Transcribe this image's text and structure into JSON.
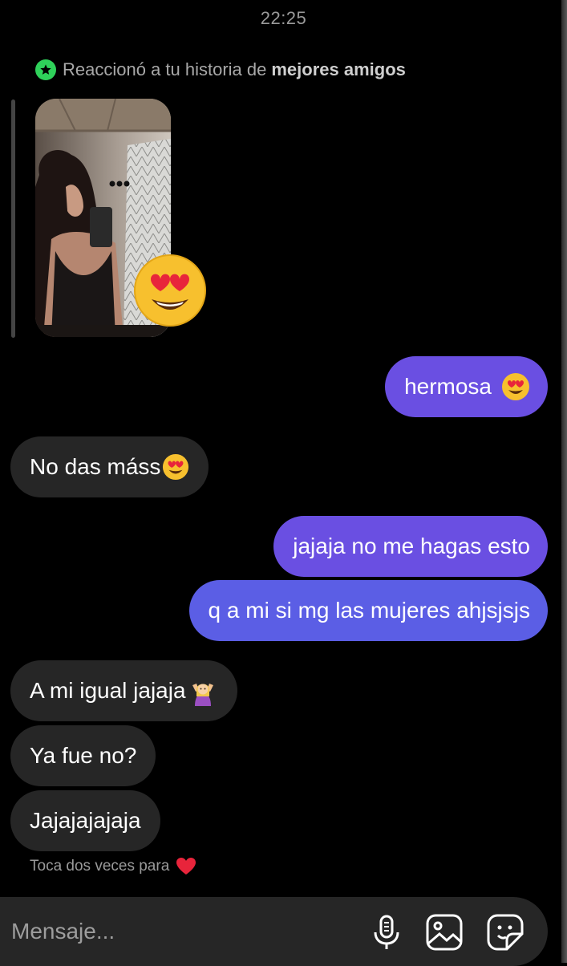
{
  "header": {
    "timestamp": "22:25"
  },
  "story_reaction": {
    "prefix": "Reaccionó a tu historia de",
    "highlight": "mejores amigos",
    "star_color": "#2fd15a",
    "reaction_emoji": "heart-eyes-emoji"
  },
  "messages": [
    {
      "from": "me",
      "text": "hermosa",
      "emoji": "heart-eyes-emoji"
    },
    {
      "from": "them",
      "text": "No das máss",
      "emoji": "heart-eyes-emoji"
    },
    {
      "from": "me",
      "text": "jajaja no me hagas esto"
    },
    {
      "from": "me",
      "text": "q a mi si mg las mujeres ahjsjsjs"
    },
    {
      "from": "them",
      "text": "A mi igual jajaja",
      "emoji": "shrugging-woman-emoji"
    },
    {
      "from": "them",
      "text": "Ya fue no?"
    },
    {
      "from": "them",
      "text": "Jajajajajaja"
    }
  ],
  "hint": {
    "text": "Toca dos veces para",
    "icon": "red-heart-icon"
  },
  "composer": {
    "placeholder": "Mensaje...",
    "icons": [
      "microphone-icon",
      "photo-gallery-icon",
      "sticker-icon"
    ]
  },
  "colors": {
    "sent_bubble": "#6a4fe2",
    "sent_bubble_alt": "#5b5ee5",
    "received_bubble": "#262626",
    "background": "#000000"
  }
}
